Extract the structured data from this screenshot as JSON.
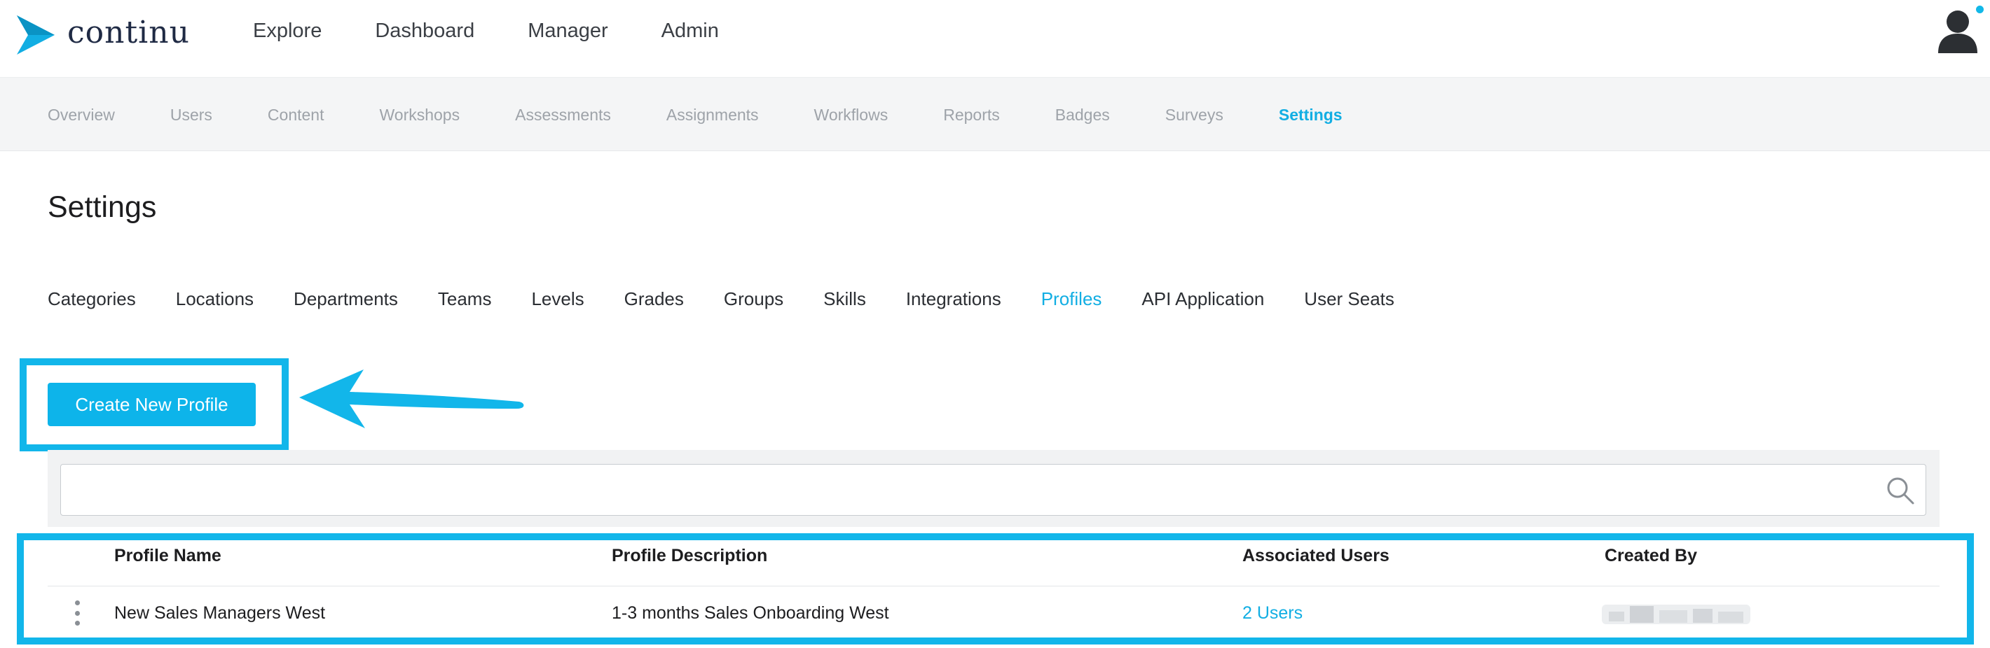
{
  "brand": {
    "name": "continu"
  },
  "main_nav": [
    "Explore",
    "Dashboard",
    "Manager",
    "Admin"
  ],
  "sub_nav": {
    "items": [
      "Overview",
      "Users",
      "Content",
      "Workshops",
      "Assessments",
      "Assignments",
      "Workflows",
      "Reports",
      "Badges",
      "Surveys",
      "Settings"
    ],
    "active": "Settings"
  },
  "page_title": "Settings",
  "settings_tabs": {
    "items": [
      "Categories",
      "Locations",
      "Departments",
      "Teams",
      "Levels",
      "Grades",
      "Groups",
      "Skills",
      "Integrations",
      "Profiles",
      "API Application",
      "User Seats"
    ],
    "active": "Profiles"
  },
  "create_button": "Create New Profile",
  "search": {
    "value": "",
    "placeholder": ""
  },
  "table": {
    "headers": [
      "Profile Name",
      "Profile Description",
      "Associated Users",
      "Created By"
    ],
    "rows": [
      {
        "name": "New Sales Managers West",
        "description": "1-3 months Sales Onboarding West",
        "users": "2 Users",
        "created_by": ""
      }
    ]
  },
  "colors": {
    "accent": "#12aee3",
    "highlight": "#12b6ea",
    "button": "#0db4ea",
    "brand_dark": "#1f2a44"
  },
  "icons": [
    "continu-logo-icon",
    "user-avatar-icon",
    "notification-dot",
    "search-icon",
    "kebab-menu-icon",
    "annotation-arrow"
  ]
}
